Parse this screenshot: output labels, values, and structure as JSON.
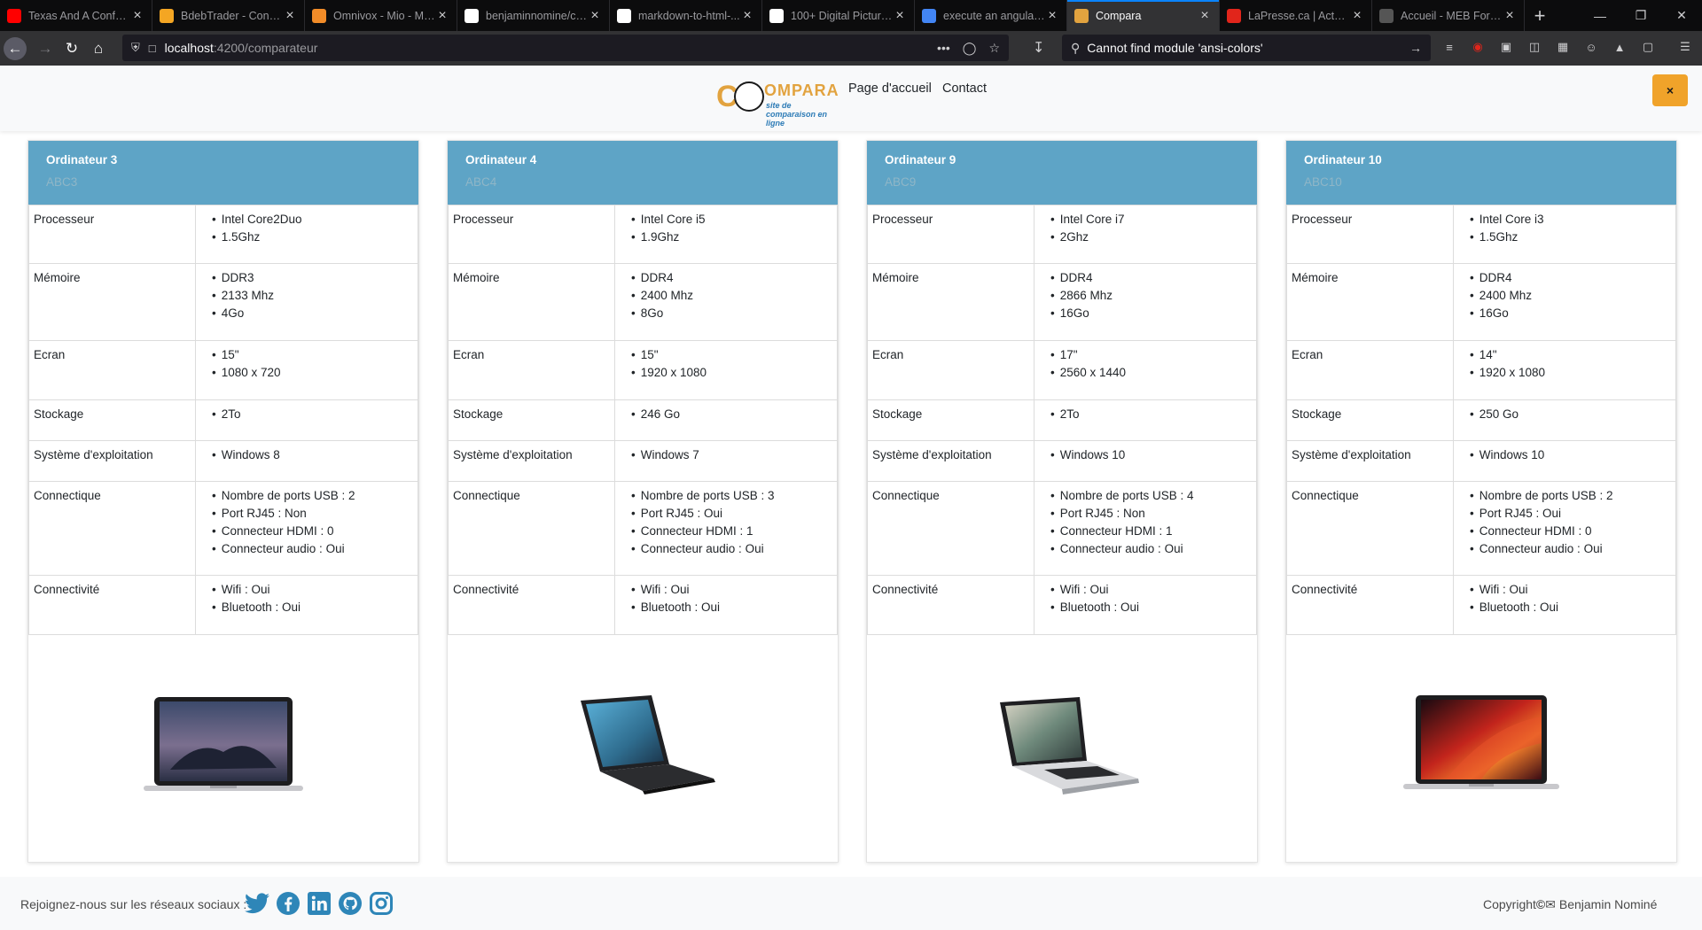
{
  "browser": {
    "tabs": [
      {
        "title": "Texas And A Confe...",
        "favicon": "youtube-icon",
        "color": "#ff0000"
      },
      {
        "title": "BdebTrader - Conso...",
        "favicon": "flame-icon",
        "color": "#f4a623"
      },
      {
        "title": "Omnivox - Mio - Me...",
        "favicon": "flower-icon",
        "color": "#f28c28"
      },
      {
        "title": "benjaminnomine/co...",
        "favicon": "github-icon",
        "color": "#ffffff"
      },
      {
        "title": "markdown-to-html-...",
        "favicon": "github-icon",
        "color": "#ffffff"
      },
      {
        "title": "100+ Digital Picture...",
        "favicon": "unsplash-icon",
        "color": "#ffffff"
      },
      {
        "title": "execute an angular ...",
        "favicon": "google-icon",
        "color": "#4285f4"
      },
      {
        "title": "Compara",
        "favicon": "compara-icon",
        "color": "#e2a33f"
      },
      {
        "title": "LaPresse.ca | Actuali...",
        "favicon": "lapresse-icon",
        "color": "#e1251b"
      },
      {
        "title": "Accueil - MEB Forma...",
        "favicon": "meb-icon",
        "color": "#555555"
      }
    ],
    "active_tab": 7,
    "url_host": "localhost",
    "url_path": ":4200/comparateur",
    "search_text": "Cannot find module 'ansi-colors'"
  },
  "header": {
    "logo_word": "OMPARA",
    "logo_tagline": "site de comparaison en ligne",
    "nav": [
      "Page d'accueil",
      "Contact"
    ],
    "close_label": "×"
  },
  "labels": [
    "Processeur",
    "Mémoire",
    "Ecran",
    "Stockage",
    "Système d'exploitation",
    "Connectique",
    "Connectivité"
  ],
  "computers": [
    {
      "name": "Ordinateur 3",
      "code": "ABC3",
      "processeur": [
        "Intel Core2Duo",
        "1.5Ghz"
      ],
      "memoire": [
        "DDR3",
        "2133 Mhz",
        "4Go"
      ],
      "ecran": [
        "15\"",
        "1080 x 720"
      ],
      "stockage": [
        "2To"
      ],
      "os": [
        "Windows 8"
      ],
      "connectique": [
        "Nombre de ports USB : 2",
        "Port RJ45 : Non",
        "Connecteur HDMI : 0",
        "Connecteur audio : Oui"
      ],
      "connectivite": [
        "Wifi : Oui",
        "Bluetooth : Oui"
      ],
      "image": "macbook-catalina"
    },
    {
      "name": "Ordinateur 4",
      "code": "ABC4",
      "processeur": [
        "Intel Core i5",
        "1.9Ghz"
      ],
      "memoire": [
        "DDR4",
        "2400 Mhz",
        "8Go"
      ],
      "ecran": [
        "15\"",
        "1920 x 1080"
      ],
      "stockage": [
        "246 Go"
      ],
      "os": [
        "Windows 7"
      ],
      "connectique": [
        "Nombre de ports USB : 3",
        "Port RJ45 : Oui",
        "Connecteur HDMI : 1",
        "Connecteur audio : Oui"
      ],
      "connectivite": [
        "Wifi : Oui",
        "Bluetooth : Oui"
      ],
      "image": "dell-inspiron"
    },
    {
      "name": "Ordinateur 9",
      "code": "ABC9",
      "processeur": [
        "Intel Core i7",
        "2Ghz"
      ],
      "memoire": [
        "DDR4",
        "2866 Mhz",
        "16Go"
      ],
      "ecran": [
        "17\"",
        "2560 x 1440"
      ],
      "stockage": [
        "2To"
      ],
      "os": [
        "Windows 10"
      ],
      "connectique": [
        "Nombre de ports USB : 4",
        "Port RJ45 : Non",
        "Connecteur HDMI : 1",
        "Connecteur audio : Oui"
      ],
      "connectivite": [
        "Wifi : Oui",
        "Bluetooth : Oui"
      ],
      "image": "asus-chromebook"
    },
    {
      "name": "Ordinateur 10",
      "code": "ABC10",
      "processeur": [
        "Intel Core i3",
        "1.5Ghz"
      ],
      "memoire": [
        "DDR4",
        "2400 Mhz",
        "16Go"
      ],
      "ecran": [
        "14\"",
        "1920 x 1080"
      ],
      "stockage": [
        "250 Go"
      ],
      "os": [
        "Windows 10"
      ],
      "connectique": [
        "Nombre de ports USB : 2",
        "Port RJ45 : Oui",
        "Connecteur HDMI : 0",
        "Connecteur audio : Oui"
      ],
      "connectivite": [
        "Wifi : Oui",
        "Bluetooth : Oui"
      ],
      "image": "macbook-pro-16"
    }
  ],
  "footer": {
    "join_text": "Rejoignez-nous sur les réseaux sociaux :",
    "social": [
      "twitter-icon",
      "facebook-icon",
      "linkedin-icon",
      "github-icon",
      "instagram-icon"
    ],
    "social_color": "#2e86b8",
    "copyright": "Copyright",
    "author": "Benjamin Nominé"
  },
  "colors": {
    "card_header": "#5ea4c6",
    "close_button": "#f0a32a",
    "brand": "#e2a33f"
  }
}
